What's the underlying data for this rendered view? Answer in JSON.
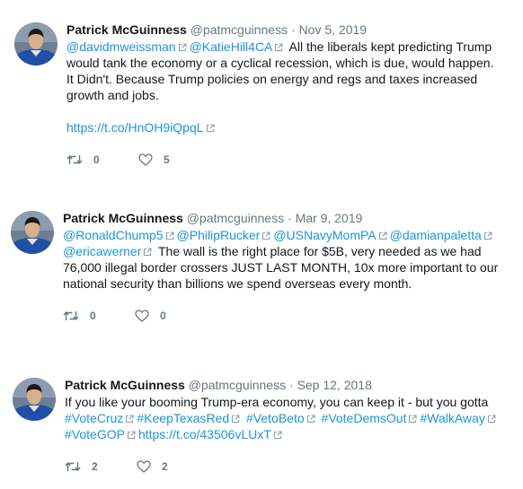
{
  "tweets": [
    {
      "name": "Patrick McGuinness",
      "handle": "@patmcguinness",
      "sep": "·",
      "date": "Nov 5, 2019",
      "mentions": [
        "@davidmweissman",
        "@KatieHill4CA"
      ],
      "text": "All the liberals  kept predicting Trump would tank the economy or a cyclical recession, which is due, would happen. It Didn't. Because Trump policies on energy and regs and taxes increased growth and jobs.",
      "link": "https://t.co/HnOH9iQpqL",
      "retweets": "0",
      "likes": "5"
    },
    {
      "name": "Patrick McGuinness",
      "handle": "@patmcguinness",
      "sep": "·",
      "date": "Mar 9, 2019",
      "mentions": [
        "@RonaldChump5",
        "@PhilipRucker",
        "@USNavyMomPA",
        "@damianpaletta",
        "@ericawerner"
      ],
      "text": "The wall is the right place for $5B, very needed as we had 76,000 illegal border crossers JUST LAST MONTH, 10x more important to our national security than billions we spend overseas every month.",
      "retweets": "0",
      "likes": "0"
    },
    {
      "name": "Patrick McGuinness",
      "handle": "@patmcguinness",
      "sep": "·",
      "date": "Sep 12, 2018",
      "text": "If you like your booming Trump-era economy, you can keep it - but you gotta",
      "hashtags": [
        "#VoteCruz",
        "#KeepTexasRed",
        "#VetoBeto",
        "#VoteDemsOut",
        "#WalkAway",
        "#VoteGOP"
      ],
      "link": "https://t.co/43506vLUxT",
      "retweets": "2",
      "likes": "2"
    }
  ],
  "icons": {
    "external": "external-link-icon",
    "retweet": "retweet-icon",
    "like": "heart-icon"
  },
  "colors": {
    "link": "#1b95e0",
    "muted": "#657786",
    "text": "#14171a"
  }
}
